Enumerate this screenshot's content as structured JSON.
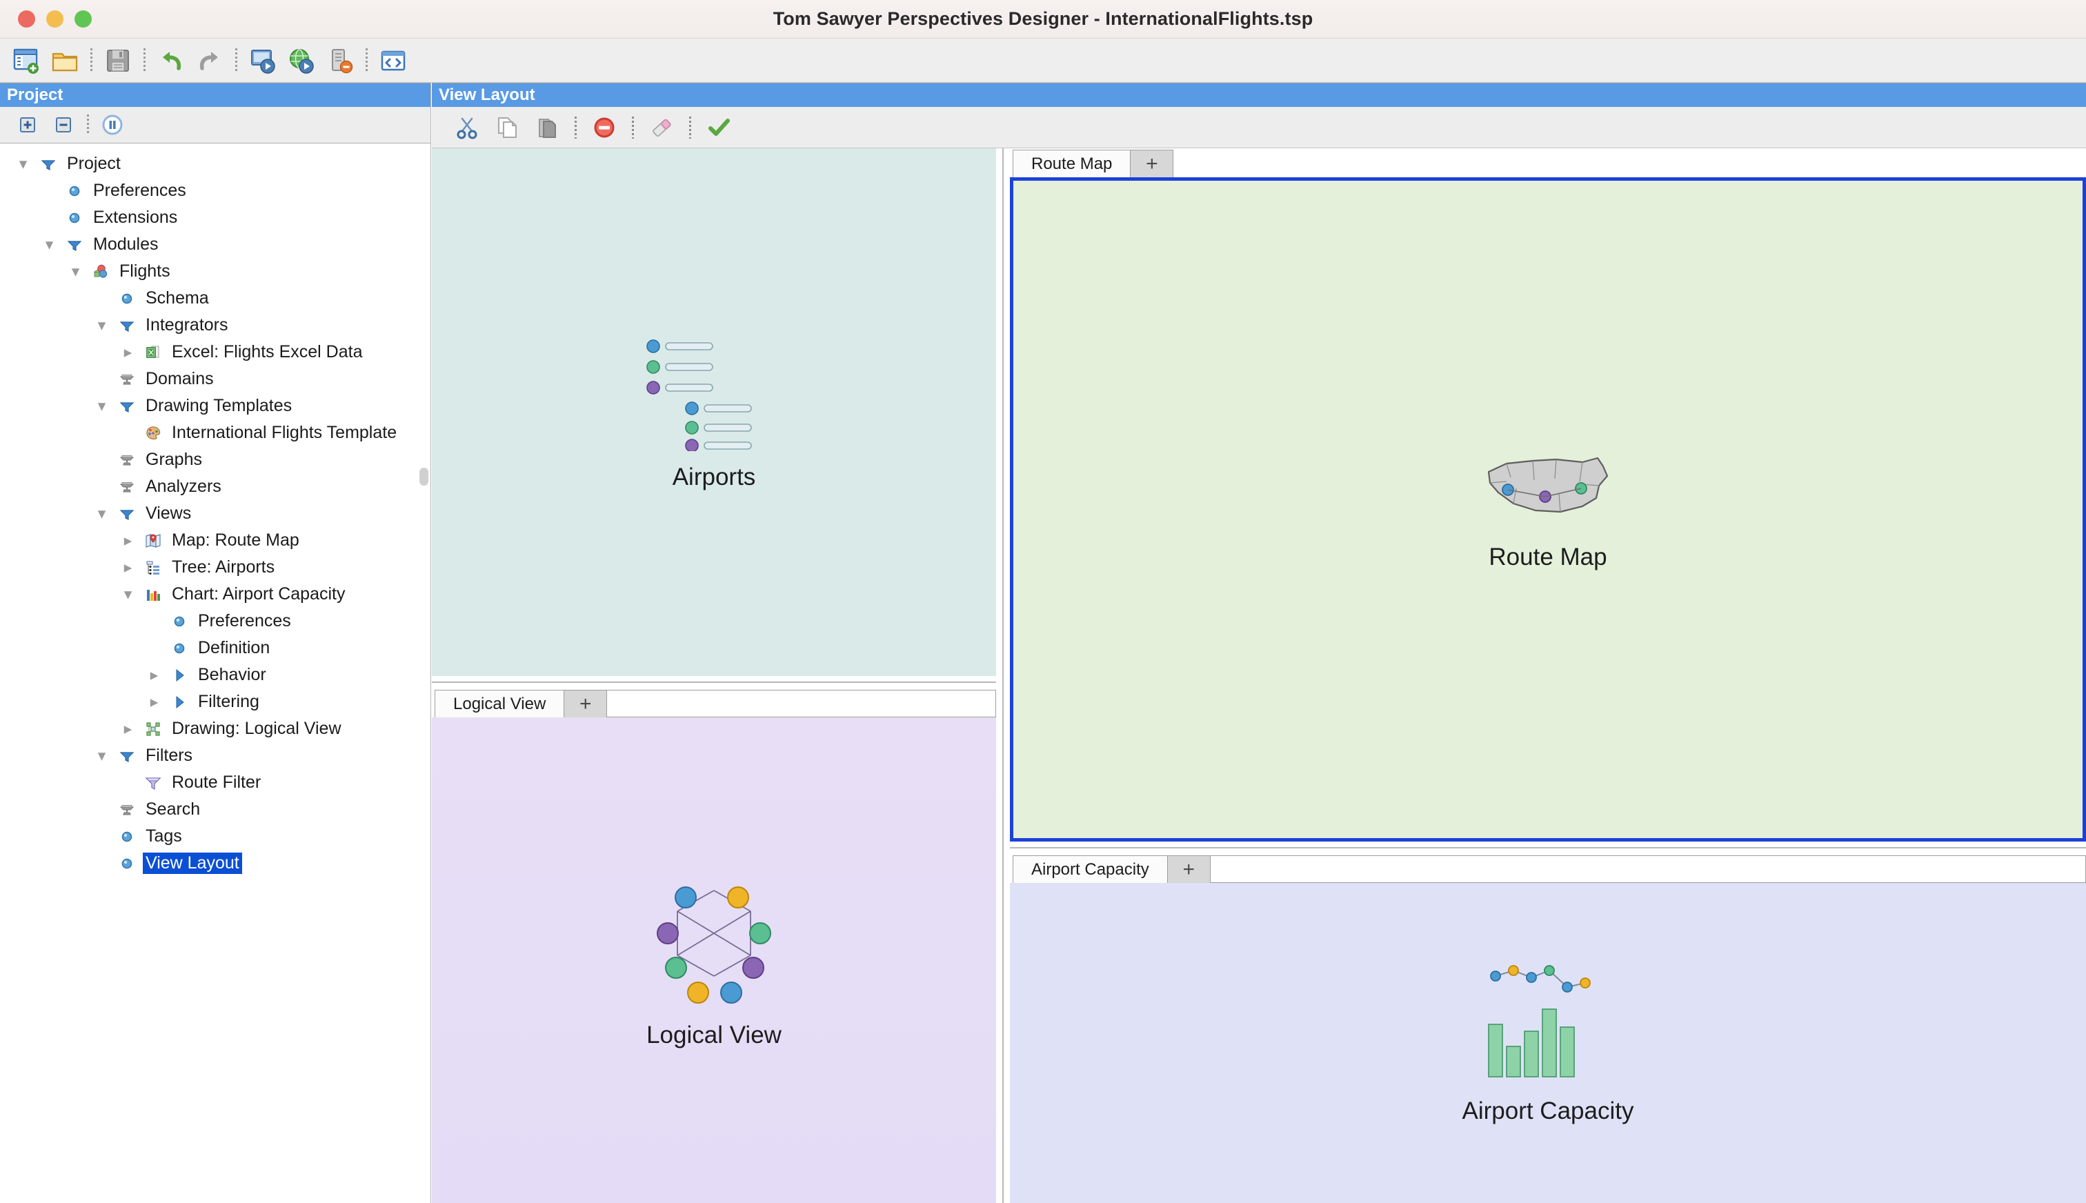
{
  "window": {
    "title": "Tom Sawyer Perspectives Designer - InternationalFlights.tsp",
    "traffic_lights": [
      "close",
      "minimize",
      "zoom"
    ]
  },
  "main_toolbar": {
    "buttons": [
      {
        "name": "new-project-button",
        "icon": "new-project-icon",
        "tooltip": "New Project"
      },
      {
        "name": "open-project-button",
        "icon": "open-folder-icon",
        "tooltip": "Open Project"
      },
      {
        "name": "save-button",
        "icon": "save-floppy-icon",
        "tooltip": "Save"
      },
      {
        "name": "undo-button",
        "icon": "undo-arrow-icon",
        "tooltip": "Undo"
      },
      {
        "name": "redo-button",
        "icon": "redo-arrow-icon",
        "tooltip": "Redo"
      },
      {
        "name": "run-desktop-button",
        "icon": "run-desktop-icon",
        "tooltip": "Run Desktop"
      },
      {
        "name": "run-web-button",
        "icon": "run-web-globe-icon",
        "tooltip": "Run Web"
      },
      {
        "name": "stop-server-button",
        "icon": "server-stop-icon",
        "tooltip": "Stop Server"
      },
      {
        "name": "source-code-button",
        "icon": "code-brackets-icon",
        "tooltip": "Source Code"
      }
    ]
  },
  "project_panel": {
    "header": "Project",
    "toolbar": [
      {
        "name": "expand-all-button",
        "icon": "plus-box-icon"
      },
      {
        "name": "collapse-all-button",
        "icon": "minus-box-icon"
      },
      {
        "name": "pause-button",
        "icon": "pause-circle-icon"
      }
    ],
    "tree": [
      {
        "label": "Project",
        "depth": 0,
        "twisty": "down",
        "icon": "funnel-blue-icon",
        "selected": false
      },
      {
        "label": "Preferences",
        "depth": 1,
        "twisty": "none",
        "icon": "blue-dot-icon",
        "selected": false
      },
      {
        "label": "Extensions",
        "depth": 1,
        "twisty": "none",
        "icon": "blue-dot-icon",
        "selected": false
      },
      {
        "label": "Modules",
        "depth": 1,
        "twisty": "down",
        "icon": "funnel-blue-icon",
        "selected": false
      },
      {
        "label": "Flights",
        "depth": 2,
        "twisty": "down",
        "icon": "modules-cubes-icon",
        "selected": false
      },
      {
        "label": "Schema",
        "depth": 3,
        "twisty": "none",
        "icon": "blue-dot-icon",
        "selected": false
      },
      {
        "label": "Integrators",
        "depth": 3,
        "twisty": "down",
        "icon": "funnel-blue-icon",
        "selected": false
      },
      {
        "label": "Excel: Flights Excel Data",
        "depth": 4,
        "twisty": "right",
        "icon": "excel-sheet-icon",
        "selected": false
      },
      {
        "label": "Domains",
        "depth": 3,
        "twisty": "none",
        "icon": "anvil-gray-icon",
        "selected": false
      },
      {
        "label": "Drawing Templates",
        "depth": 3,
        "twisty": "down",
        "icon": "funnel-blue-icon",
        "selected": false
      },
      {
        "label": "International Flights Template",
        "depth": 4,
        "twisty": "none",
        "icon": "palette-icon",
        "selected": false
      },
      {
        "label": "Graphs",
        "depth": 3,
        "twisty": "none",
        "icon": "anvil-gray-icon",
        "selected": false
      },
      {
        "label": "Analyzers",
        "depth": 3,
        "twisty": "none",
        "icon": "anvil-gray-icon",
        "selected": false
      },
      {
        "label": "Views",
        "depth": 3,
        "twisty": "down",
        "icon": "funnel-blue-icon",
        "selected": false
      },
      {
        "label": "Map: Route Map",
        "depth": 4,
        "twisty": "right",
        "icon": "map-pin-icon",
        "selected": false
      },
      {
        "label": "Tree: Airports",
        "depth": 4,
        "twisty": "right",
        "icon": "tree-list-icon",
        "selected": false
      },
      {
        "label": "Chart: Airport Capacity",
        "depth": 4,
        "twisty": "down",
        "icon": "bar-chart-icon",
        "selected": false
      },
      {
        "label": "Preferences",
        "depth": 5,
        "twisty": "none",
        "icon": "blue-dot-icon",
        "selected": false
      },
      {
        "label": "Definition",
        "depth": 5,
        "twisty": "none",
        "icon": "blue-dot-icon",
        "selected": false
      },
      {
        "label": "Behavior",
        "depth": 5,
        "twisty": "right",
        "icon": "blue-triangle-icon",
        "selected": false
      },
      {
        "label": "Filtering",
        "depth": 5,
        "twisty": "right",
        "icon": "blue-triangle-icon",
        "selected": false
      },
      {
        "label": "Drawing: Logical View",
        "depth": 4,
        "twisty": "right",
        "icon": "drawing-nodes-icon",
        "selected": false
      },
      {
        "label": "Filters",
        "depth": 3,
        "twisty": "down",
        "icon": "funnel-blue-icon",
        "selected": false
      },
      {
        "label": "Route Filter",
        "depth": 4,
        "twisty": "none",
        "icon": "filter-funnel-icon",
        "selected": false
      },
      {
        "label": "Search",
        "depth": 3,
        "twisty": "none",
        "icon": "anvil-gray-icon",
        "selected": false
      },
      {
        "label": "Tags",
        "depth": 3,
        "twisty": "none",
        "icon": "blue-dot-icon",
        "selected": false
      },
      {
        "label": "View Layout",
        "depth": 3,
        "twisty": "none",
        "icon": "blue-dot-icon",
        "selected": true
      }
    ]
  },
  "view_layout_panel": {
    "header": "View Layout",
    "toolbar": [
      {
        "name": "cut-button",
        "icon": "scissors-icon"
      },
      {
        "name": "copy-button",
        "icon": "copy-pages-icon"
      },
      {
        "name": "paste-button",
        "icon": "paste-clipboard-icon"
      },
      {
        "name": "delete-button",
        "icon": "delete-circle-icon"
      },
      {
        "name": "clear-button",
        "icon": "eraser-icon"
      },
      {
        "name": "apply-button",
        "icon": "green-check-icon"
      }
    ],
    "panes": [
      {
        "id": "airports",
        "tabs": [],
        "label": "Airports",
        "thumbnail": "tree-list-thumbnail",
        "background": "#d9eae8",
        "selected": false
      },
      {
        "id": "route-map",
        "tabs": [
          {
            "label": "Route Map",
            "active": true
          },
          {
            "label": "+",
            "active": false
          }
        ],
        "label": "Route Map",
        "thumbnail": "us-map-thumbnail",
        "background": "#e4f0da",
        "selected": true,
        "selection_color": "#1b41d8"
      },
      {
        "id": "logical-view",
        "tabs": [
          {
            "label": "Logical View",
            "active": true
          },
          {
            "label": "+",
            "active": false
          }
        ],
        "label": "Logical View",
        "thumbnail": "graph-ring-thumbnail",
        "background": "#e6ddf6",
        "selected": false
      },
      {
        "id": "airport-capacity",
        "tabs": [
          {
            "label": "Airport Capacity",
            "active": true
          },
          {
            "label": "+",
            "active": false
          }
        ],
        "label": "Airport Capacity",
        "thumbnail": "bar-line-chart-thumbnail",
        "background": "#dfe2f6",
        "selected": false
      }
    ]
  },
  "colors": {
    "panel_header": "#589ae4",
    "selection": "#0a4fd4",
    "pane_selection_border": "#1b41d8",
    "toolbar_bg": "#ededed",
    "node_blue": "#4a9bd4",
    "node_purple": "#8a66b5",
    "node_green": "#5cbf92",
    "node_orange": "#f0b429"
  }
}
